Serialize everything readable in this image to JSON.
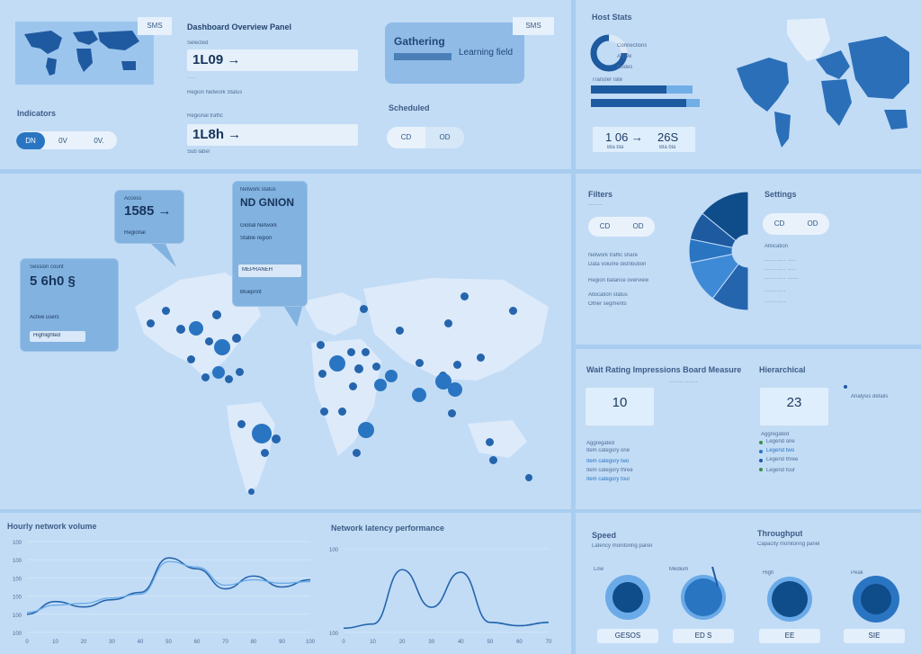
{
  "header": {
    "badge": "SMS",
    "title": "Dashboard Overview Panel",
    "field1_label": "Selected",
    "field1_value": "1L09 →",
    "field1_caption": "Region   Network   Status",
    "field2_label": "Regional traffic",
    "field2_value": "1L8h →",
    "field2_caption": "Sub label",
    "segment_label": "Indicators",
    "segment_options": [
      "DN",
      "0V",
      "0V."
    ],
    "promo_title": "Gathering",
    "promo_subtitle": "Learning field",
    "promo_badge": "SMS",
    "toggle_label": "Scheduled",
    "toggle_options": [
      "CD",
      "OD"
    ]
  },
  "summary": {
    "title": "Host Stats",
    "ring_labels": [
      "Connections",
      "Active",
      "Nodes"
    ],
    "bar_captions": [
      "Transfer rate",
      "Response load"
    ],
    "stats": [
      {
        "value": "1 06 →",
        "caption": "Bla bla"
      },
      {
        "value": "26S",
        "caption": "Bla bla"
      }
    ],
    "bars": [
      0.74,
      0.88
    ]
  },
  "map_section": {
    "callout_left": {
      "label": "Session count",
      "value": "5 6h0 §",
      "sub1": "Active users",
      "sub2": "Highlighted"
    },
    "callout_mid": {
      "label": "Access",
      "value": "1585 →",
      "sub": "Regional"
    },
    "callout_top": {
      "label": "Network status",
      "value": "ND GNION",
      "sub1": "Global Network",
      "sub2": "Stable region",
      "sub3": "MEPRANEH",
      "badge": "Blueprint"
    }
  },
  "pie_panel": {
    "title": "Filters",
    "toggle_options": [
      "CD",
      "OD"
    ],
    "right_title": "Settings",
    "right_toggle": [
      "CD",
      "OD"
    ],
    "right_heading": "Allocation",
    "lines": [
      "Network traffic share",
      "Data volume distribution",
      "Region balance overview",
      "Allocation status",
      "Other segments"
    ],
    "slices": [
      0.22,
      0.12,
      0.1,
      0.18,
      0.16
    ]
  },
  "metrics": {
    "title": "Wait Rating Impressions Board Measure",
    "right_title": "Hierarchical",
    "stat_a": "10",
    "stat_b": "23",
    "stat_a_caption": "Aggregated",
    "stat_b_caption": "Aggregated",
    "right_note": "Analysis details",
    "legend": [
      "Legend one",
      "Legend two",
      "Legend three",
      "Legend four"
    ],
    "list_left": [
      "Item category one",
      "Item category two",
      "Item category three",
      "Item category four"
    ]
  },
  "line_chart_1": {
    "title": "Hourly network volume",
    "y_ticks": [
      "100",
      "100",
      "100",
      "100",
      "100",
      "100"
    ],
    "x_ticks": [
      "0",
      "10",
      "20",
      "30",
      "40",
      "50",
      "60",
      "70",
      "80",
      "90",
      "100"
    ]
  },
  "line_chart_2": {
    "title": "Network latency performance",
    "y_ticks": [
      "100",
      "100"
    ],
    "x_ticks": [
      "0",
      "10",
      "20",
      "30",
      "40",
      "50",
      "60",
      "70"
    ]
  },
  "gauges": {
    "left_title": "Speed",
    "left_subtitle": "Latency monitoring panel",
    "right_title": "Throughput",
    "right_subtitle": "Capacity monitoring panel",
    "items": [
      {
        "label": "Low",
        "value": "GESOS"
      },
      {
        "label": "Medium",
        "value": "ED S"
      },
      {
        "label": "High",
        "value": "EE"
      },
      {
        "label": "Peak",
        "value": "SIE"
      }
    ]
  },
  "chart_data": [
    {
      "type": "line",
      "title": "Hourly network volume",
      "x": [
        0,
        10,
        20,
        30,
        40,
        50,
        60,
        70,
        80,
        90,
        100
      ],
      "series": [
        {
          "values": [
            20,
            34,
            28,
            36,
            44,
            82,
            70,
            48,
            62,
            50,
            58
          ]
        },
        {
          "values": [
            22,
            30,
            32,
            38,
            42,
            78,
            72,
            52,
            58,
            54,
            56
          ]
        }
      ],
      "ylim": [
        0,
        100
      ]
    },
    {
      "type": "line",
      "title": "Network latency performance",
      "x": [
        0,
        10,
        20,
        30,
        40,
        50,
        60,
        70
      ],
      "series": [
        {
          "values": [
            5,
            10,
            75,
            30,
            72,
            12,
            8,
            12
          ]
        }
      ],
      "ylim": [
        0,
        100
      ]
    }
  ],
  "colors": {
    "background": "#a9cdef",
    "panel": "#c2dcf6",
    "accent": "#2a75c2",
    "dark": "#0f4c8a",
    "green": "#3a8f4a"
  }
}
